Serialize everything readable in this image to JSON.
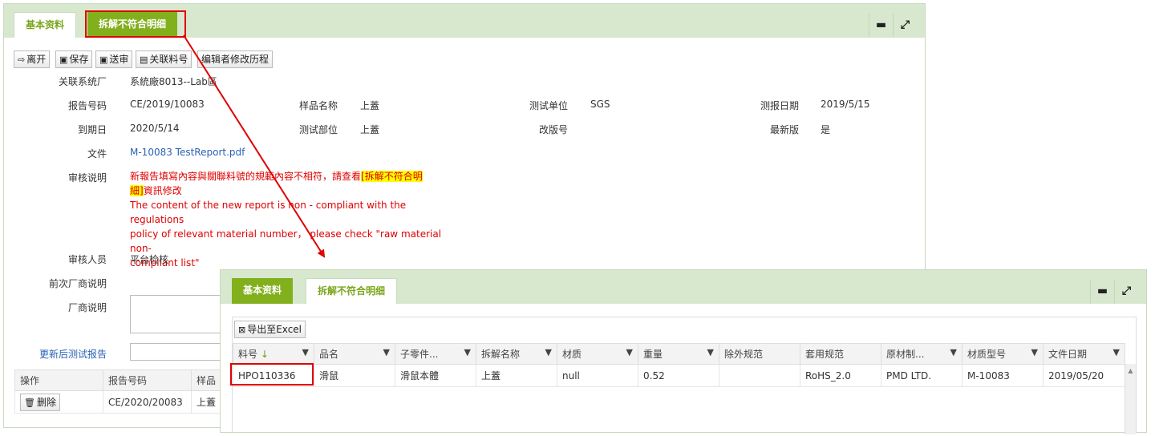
{
  "main": {
    "tabs": [
      {
        "label": "基本资料"
      },
      {
        "label": "拆解不符合明细"
      }
    ],
    "toolbar": {
      "leave": "离开",
      "save": "保存",
      "submit": "送审",
      "link_part": "关联料号",
      "edit_history": "编辑者修改历程"
    },
    "fields": {
      "system_factory_label": "关联系统厂",
      "system_factory_value": "系統廠8013--Lab區",
      "report_no_label": "报告号码",
      "report_no_value": "CE/2019/10083",
      "sample_name_label": "样品名称",
      "sample_name_value": "上蓋",
      "test_unit_label": "测试单位",
      "test_unit_value": "SGS",
      "report_date_label": "测报日期",
      "report_date_value": "2019/5/15",
      "due_date_label": "到期日",
      "due_date_value": "2020/5/14",
      "test_part_label": "测试部位",
      "test_part_value": "上蓋",
      "revision_label": "改版号",
      "revision_value": "",
      "latest_label": "最新版",
      "latest_value": "是",
      "file_label": "文件",
      "file_value": "M-10083 TestReport.pdf",
      "review_note_label": "审核说明",
      "review_note_cn_pre": "新報告填寫內容與關聯料號的規範內容不相符，請查看",
      "review_note_cn_hl1": "[拆解不符合明",
      "review_note_cn_hl2": "細]",
      "review_note_cn_post": "資訊修改",
      "review_note_en_1": "The content of the new report is non - compliant with the regulations",
      "review_note_en_2": "policy of relevant material number， please check \"raw material non-",
      "review_note_en_3": "compliant list\"",
      "reviewer_label": "审核人员",
      "reviewer_value": "平台检核",
      "prev_vendor_note_label": "前次厂商说明",
      "vendor_note_label": "厂商说明",
      "updated_report_label": "更新后测试报告"
    },
    "table": {
      "headers": [
        "操作",
        "报告号码",
        "样品"
      ],
      "rows": [
        {
          "action": "删除",
          "report_no": "CE/2020/20083",
          "sample": "上蓋"
        }
      ]
    }
  },
  "detail": {
    "tabs": [
      {
        "label": "基本资料"
      },
      {
        "label": "拆解不符合明细"
      }
    ],
    "export_label": "导出至Excel",
    "headers": [
      "料号",
      "品名",
      "子零件...",
      "拆解名称",
      "材质",
      "重量",
      "除外规范",
      "套用规范",
      "原材制...",
      "材质型号",
      "文件日期"
    ],
    "rows": [
      [
        "HPO110336",
        "滑鼠",
        "滑鼠本體",
        "上蓋",
        "null",
        "0.52",
        "",
        "RoHS_2.0",
        "PMD LTD.",
        "M-10083",
        "2019/05/20"
      ]
    ]
  },
  "colors": {
    "tab_green": "#82b01d",
    "tab_bar": "#d7e8cf",
    "annotation_red": "#e00000",
    "link_blue": "#2a62b3"
  }
}
